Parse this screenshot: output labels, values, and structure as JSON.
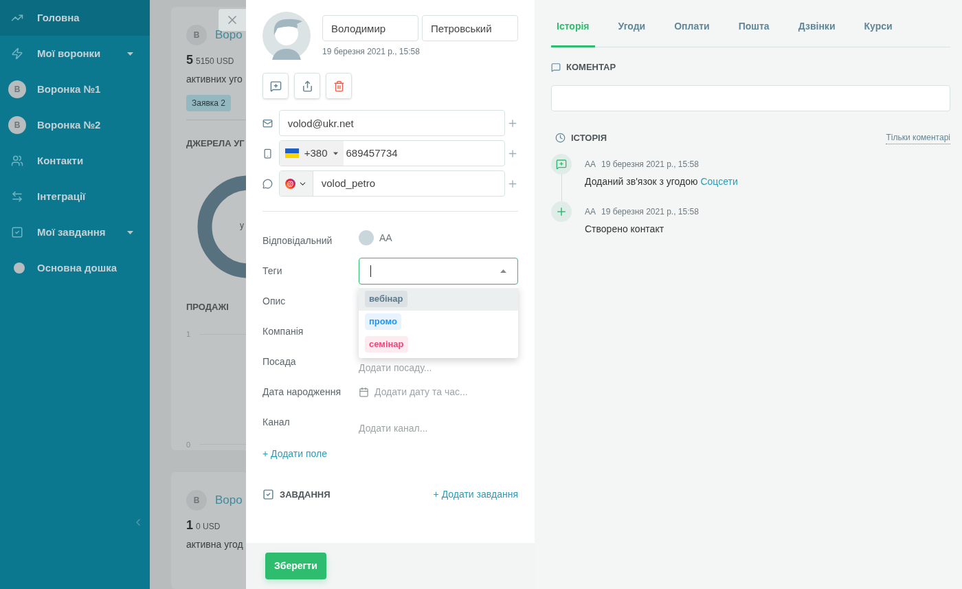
{
  "sidebar": {
    "items": [
      {
        "kind": "link",
        "label": "Головна",
        "selected": true
      },
      {
        "kind": "group",
        "label": "Мої воронки",
        "selected": false
      },
      {
        "kind": "funnel",
        "avatar": "В",
        "label": "Воронка №1",
        "selected": false
      },
      {
        "kind": "funnel",
        "avatar": "В",
        "label": "Воронка №2",
        "selected": false
      },
      {
        "kind": "link",
        "label": "Контакти",
        "selected": false
      },
      {
        "kind": "link",
        "label": "Інтеграції",
        "selected": false
      },
      {
        "kind": "group",
        "label": "Мої завдання",
        "selected": false
      },
      {
        "kind": "link",
        "label": "Основна дошка",
        "selected": false
      }
    ]
  },
  "dashboard": {
    "cards": [
      {
        "avatar": "В",
        "title": "Воро",
        "count": "5",
        "amount": "5150 USD",
        "caption": "активних уго",
        "badge": {
          "label": "Заявка",
          "count": "2"
        },
        "sources_title": "ДЖЕРЕЛА УГ",
        "donut_label": "у",
        "sales_title": "ПРОДАЖІ",
        "y_ticks": [
          "1",
          "0"
        ]
      },
      {
        "avatar": "В",
        "title": "Воро",
        "count": "1",
        "amount": "0 USD",
        "caption": "активна угод"
      }
    ]
  },
  "contact": {
    "first_name": "Володимир",
    "last_name": "Петровський",
    "created": "19 березня 2021 р., 15:58",
    "email": "volod@ukr.net",
    "phone": {
      "country_code": "+380",
      "number": "689457734"
    },
    "social": {
      "username": "volod_petro"
    },
    "fields": [
      {
        "kind": "user",
        "label": "Відповідальний",
        "value": "АА"
      },
      {
        "kind": "tags",
        "label": "Теги",
        "open": true,
        "options": [
          {
            "label": "вебінар",
            "color": "#5b7a8c",
            "highlighted": true
          },
          {
            "label": "промо",
            "color": "#2196f3",
            "highlighted": false
          },
          {
            "label": "семінар",
            "color": "#f0457a",
            "highlighted": false
          }
        ]
      },
      {
        "kind": "text",
        "label": "Опис"
      },
      {
        "kind": "text",
        "label": "Компанія"
      },
      {
        "kind": "text",
        "label": "Посада",
        "placeholder": "Додати посаду..."
      },
      {
        "kind": "date",
        "label": "Дата народження",
        "placeholder": "Додати дату та час..."
      },
      {
        "kind": "text",
        "label": "Канал",
        "placeholder": "Додати канал..."
      }
    ],
    "add_field": "+ Додати поле",
    "tasks": {
      "title": "ЗАВДАННЯ",
      "add": "+ Додати завдання"
    },
    "save": "Зберегти"
  },
  "activity": {
    "tabs": [
      {
        "label": "Історія",
        "selected": true
      },
      {
        "label": "Угоди",
        "selected": false
      },
      {
        "label": "Оплати",
        "selected": false
      },
      {
        "label": "Пошта",
        "selected": false
      },
      {
        "label": "Дзвінки",
        "selected": false
      },
      {
        "label": "Курси",
        "selected": false
      }
    ],
    "comment": {
      "title": "КОМЕНТАР"
    },
    "history": {
      "title": "ІСТОРІЯ",
      "filter": "Тільки коментарі",
      "entries": [
        {
          "kind": "link",
          "author": "АА",
          "time": "19 березня 2021 р., 15:58",
          "text": "Доданий зв'язок з угодою",
          "link": "Соцсети"
        },
        {
          "kind": "created",
          "author": "АА",
          "time": "19 березня 2021 р., 15:58",
          "text": "Створено контакт"
        }
      ]
    }
  }
}
